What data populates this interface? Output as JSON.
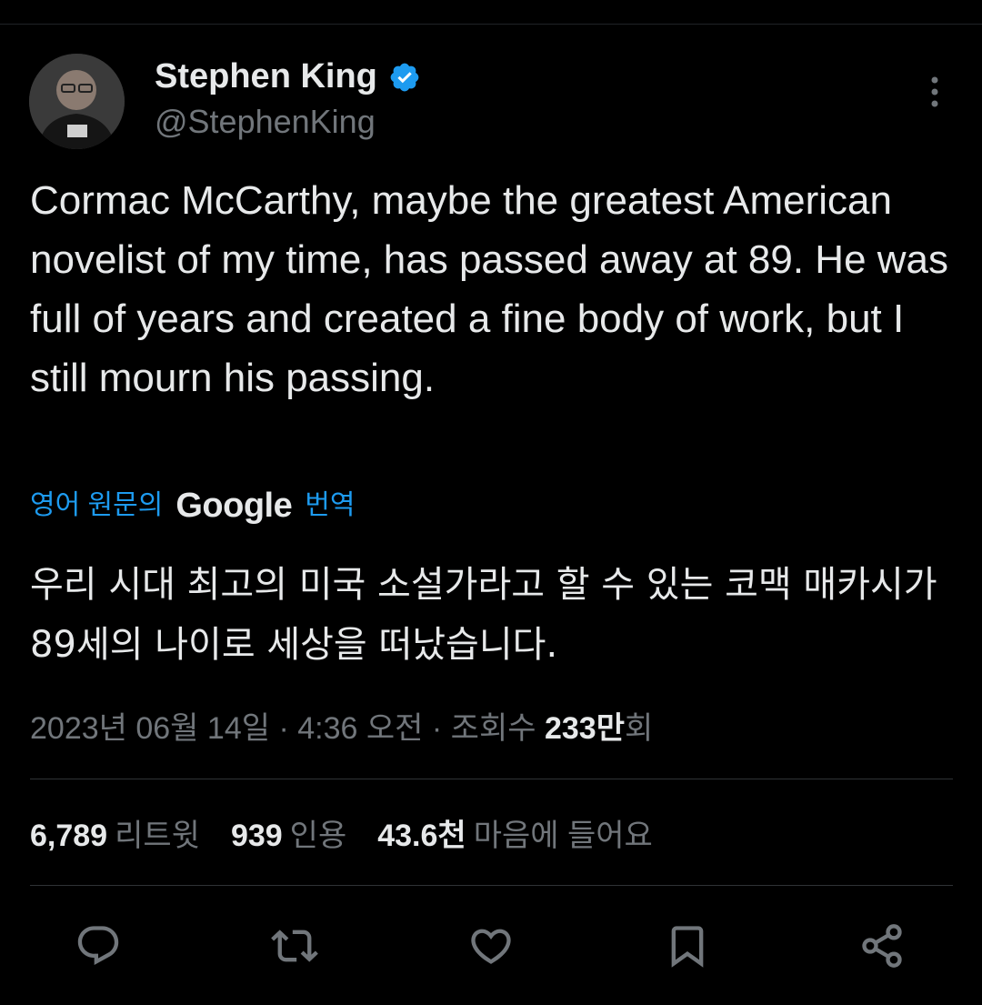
{
  "author": {
    "display_name": "Stephen King",
    "handle": "@StephenKing",
    "avatar_icon": "avatar-photo",
    "verified_color": "#1d9bf0"
  },
  "tweet": {
    "text": "Cormac McCarthy, maybe the greatest American novelist of my time, has passed away at 89. He was full of years and created a fine body of work, but I still mourn his passing.",
    "translate_prefix": "영어 원문의",
    "translate_brand": "Google",
    "translate_suffix": "번역",
    "translated_text": "우리 시대 최고의 미국 소설가라고 할 수 있는 코맥 매카시가 89세의 나이로 세상을 떠났습니다."
  },
  "meta": {
    "date": "2023년 06월 14일",
    "sep1": "·",
    "time": "4:36 오전",
    "sep2": "·",
    "views_label": "조회수",
    "views_value": "233만",
    "views_suffix": "회"
  },
  "stats": {
    "retweets_value": "6,789",
    "retweets_label": "리트윗",
    "quotes_value": "939",
    "quotes_label": "인용",
    "likes_value": "43.6천",
    "likes_label": "마음에 들어요"
  },
  "colors": {
    "background": "#000000",
    "text": "#e7e9ea",
    "secondary": "#71767b",
    "accent": "#1d9bf0",
    "divider": "#2f3336"
  },
  "actions": [
    {
      "icon": "reply-icon"
    },
    {
      "icon": "retweet-icon"
    },
    {
      "icon": "like-icon"
    },
    {
      "icon": "bookmark-icon"
    },
    {
      "icon": "share-icon"
    }
  ]
}
